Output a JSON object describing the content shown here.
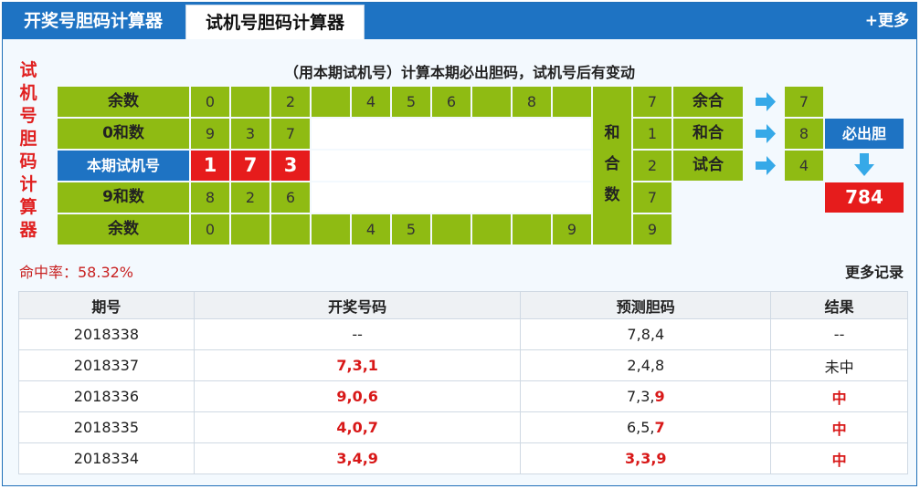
{
  "tabs": {
    "tab1": "开奖号胆码计算器",
    "tab2": "试机号胆码计算器",
    "more": "+更多"
  },
  "vertical_title": [
    "试",
    "机",
    "号",
    "胆",
    "码",
    "计",
    "算",
    "器"
  ],
  "calc_title": "（用本期试机号）计算本期必出胆码，试机号后有变动",
  "rows": {
    "r1_label": "余数",
    "r1": [
      "0",
      "",
      "2",
      "",
      "4",
      "5",
      "6",
      "",
      "8",
      ""
    ],
    "r2_label": "0和数",
    "r2": [
      "9",
      "3",
      "7"
    ],
    "r3_label": "本期试机号",
    "r3": [
      "1",
      "7",
      "3"
    ],
    "r4_label": "9和数",
    "r4": [
      "8",
      "2",
      "6"
    ],
    "r5_label": "余数",
    "r5": [
      "0",
      "",
      "",
      "",
      "4",
      "5",
      "",
      "",
      "",
      "9"
    ]
  },
  "heshu_label": [
    "和",
    "合",
    "数"
  ],
  "heshu_values": [
    "7",
    "1",
    "2",
    "7",
    "9"
  ],
  "ops": [
    {
      "label": "余合",
      "value": "7"
    },
    {
      "label": "和合",
      "value": "8"
    },
    {
      "label": "试合",
      "value": "4"
    }
  ],
  "bichu": {
    "label": "必出胆",
    "value": "784"
  },
  "hit_rate": "命中率：58.32%",
  "more_records": "更多记录",
  "table": {
    "headers": [
      "期号",
      "开奖号码",
      "预测胆码",
      "结果"
    ],
    "rows": [
      {
        "issue": "2018338",
        "draw": "--",
        "pred_normal": "7,8,4",
        "pred_hit": "",
        "result": "--"
      },
      {
        "issue": "2018337",
        "draw": "7,3,1",
        "pred_normal": "2,4,8",
        "pred_hit": "",
        "result": "未中"
      },
      {
        "issue": "2018336",
        "draw": "9,0,6",
        "pred_normal": "7,3,",
        "pred_hit": "9",
        "result": "中"
      },
      {
        "issue": "2018335",
        "draw": "4,0,7",
        "pred_normal": "6,5,",
        "pred_hit": "7",
        "result": "中"
      },
      {
        "issue": "2018334",
        "draw": "3,4,9",
        "pred_normal": "",
        "pred_hit": "3,3,9",
        "result": "中"
      }
    ]
  },
  "colors": {
    "header_blue": "#1e73c3",
    "green": "#8fbb13",
    "red": "#e61c1c",
    "arrow": "#36a9e8"
  }
}
